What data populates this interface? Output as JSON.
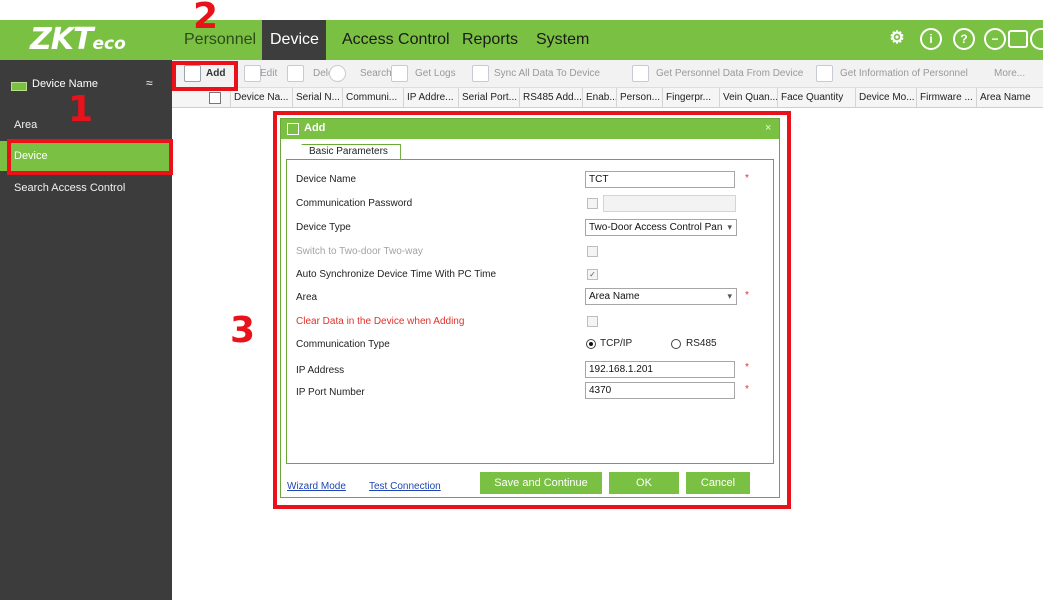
{
  "header": {
    "logo": "ZKT",
    "logo_suffix": "eco",
    "tabs": [
      "Personnel",
      "Device",
      "Access Control",
      "Reports",
      "System"
    ],
    "active_tab": "Device",
    "icons": [
      "gear-icon",
      "info-icon",
      "help-icon",
      "minimize-icon",
      "restore-icon",
      "close-icon"
    ]
  },
  "sidebar": {
    "title": "Device Name",
    "items": [
      "Area",
      "Device",
      "Search Access Control"
    ],
    "active_item": "Device"
  },
  "toolbar": {
    "buttons": [
      "Add",
      "Edit",
      "Delete",
      "Search",
      "Get Logs",
      "Sync All Data To Device",
      "Get Personnel Data From Device",
      "Get Information of Personnel",
      "More..."
    ]
  },
  "table": {
    "columns": [
      "Device Na...",
      "Serial N...",
      "Communi...",
      "IP Addre...",
      "Serial Port...",
      "RS485 Add...",
      "Enab...",
      "Person...",
      "Fingerpr...",
      "Vein Quan...",
      "Face Quantity",
      "Device Mo...",
      "Firmware ...",
      "Area Name"
    ]
  },
  "dialog": {
    "title": "Add",
    "close": "×",
    "tab": "Basic Parameters",
    "fields": {
      "device_name_label": "Device Name",
      "device_name_value": "TCT",
      "comm_password_label": "Communication Password",
      "device_type_label": "Device Type",
      "device_type_value": "Two-Door Access Control Pan",
      "switch_label": "Switch to Two-door Two-way",
      "auto_sync_label": "Auto Synchronize Device Time With PC Time",
      "area_label": "Area",
      "area_value": "Area Name",
      "clear_data_label": "Clear Data in the Device when Adding",
      "comm_type_label": "Communication Type",
      "comm_option_1": "TCP/IP",
      "comm_option_2": "RS485",
      "ip_address_label": "IP Address",
      "ip_address_value": "192.168.1.201",
      "ip_port_label": "IP Port Number",
      "ip_port_value": "4370"
    },
    "required_mark": "*",
    "footer": {
      "wizard_mode": "Wizard Mode",
      "test_connection": "Test Connection",
      "save_continue": "Save and Continue",
      "ok": "OK",
      "cancel": "Cancel"
    }
  },
  "annotations": {
    "step1": "1",
    "step2": "2",
    "step3": "3",
    "color": "#e9121a"
  },
  "colors": {
    "brand_green": "#7ac143",
    "sidebar_dark": "#3c3c3c",
    "nav_active": "#3d3d3d"
  }
}
